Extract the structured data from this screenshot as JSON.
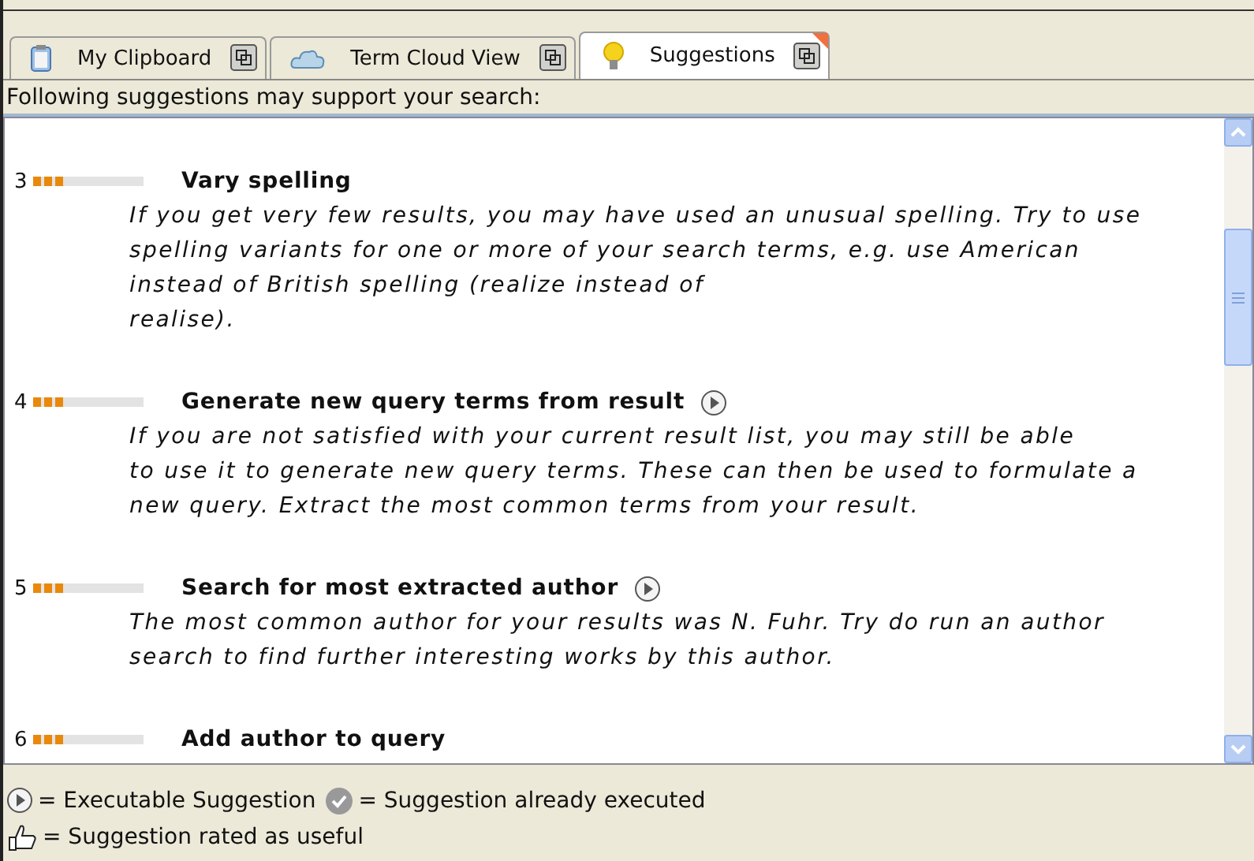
{
  "tabs": [
    {
      "label": "My Clipboard",
      "selected": false
    },
    {
      "label": "Term Cloud View",
      "selected": false
    },
    {
      "label": "Suggestions",
      "selected": true
    }
  ],
  "intro": "Following suggestions may support your search:",
  "suggestions": [
    {
      "number": "3",
      "level": 0.3,
      "title": "Vary spelling",
      "executable": false,
      "lines": [
        "If you get very few results, you may have used an unusual spelling. Try to use",
        "spelling variants for one or more of your search terms, e.g. use American",
        "instead of British spelling (realize instead of",
        "realise)."
      ]
    },
    {
      "number": "4",
      "level": 0.3,
      "title": "Generate new query terms from result",
      "executable": true,
      "lines": [
        "If you are not satisfied with your current result list, you may still be able",
        "to use it to generate new query terms. These can then be used to formulate a",
        "new query. Extract the most common terms from your result."
      ]
    },
    {
      "number": "5",
      "level": 0.3,
      "title": "Search for most extracted author",
      "executable": true,
      "lines": [
        "The most common author for your results was N. Fuhr. Try do run an author",
        "search to find further interesting works by this author."
      ]
    },
    {
      "number": "6",
      "level": 0.3,
      "title": "Add author to query",
      "executable": false
    }
  ],
  "legend": [
    {
      "kind": "play",
      "text": "= Executable Suggestion"
    },
    {
      "kind": "check",
      "text": "= Suggestion already executed"
    },
    {
      "kind": "thumb",
      "text": "= Suggestion rated as useful"
    }
  ]
}
